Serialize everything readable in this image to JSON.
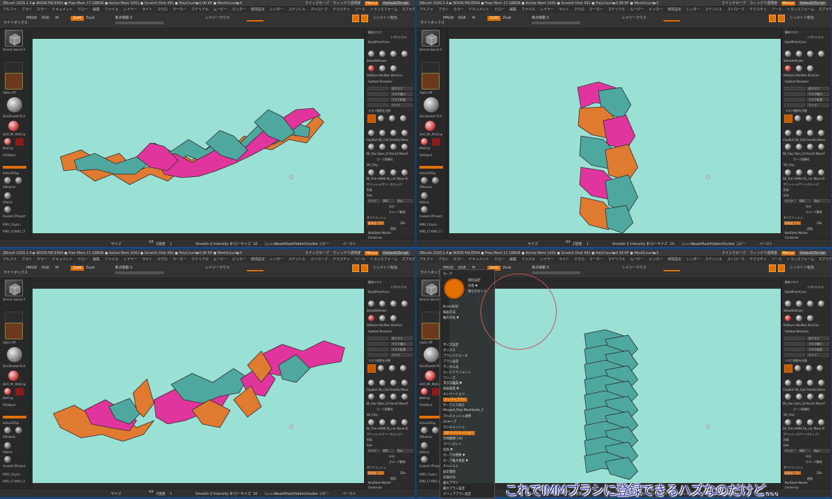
{
  "panes": [
    {
      "id": "pane1",
      "titlebar": {
        "title": "ZBrush 2020.1.4 ▶ BOON FACE004 ● Free Mem 17.188GB ● Active Mem 1041 ● Scratch Disk 491 ● PolyCount▶0.06 KP ● MeshCount▶3",
        "quicksave": "クイックセーブ",
        "transparency": "ウィンドウ透明度",
        "menus_tag": "Menus",
        "script": "DefaultZScript"
      },
      "menubar": [
        "アルファ",
        "ブラシ",
        "カラー",
        "ドキュメント",
        "ドロー",
        "編集",
        "ファイル",
        "レイヤー",
        "ライト",
        "マクロ",
        "マーカー",
        "マテリアル",
        "ムービー",
        "ピッカー",
        "環境設定",
        "レンダー",
        "ステンシル",
        "ストローク",
        "テクスチャ",
        "ツール",
        "トランスフォーム",
        "Zプラグイン",
        "Zスクリプト",
        "Zscript3",
        "Zscript2",
        "ヘルプ"
      ],
      "toolbar": {
        "lightbox": "ライトボックス",
        "mrgb": "MRGB",
        "rgb": "RGB",
        "m": "M",
        "zadd": "Zadd",
        "zsub": "Zsub",
        "focal": "焦点移動 0",
        "lazy": "レイジーマウス",
        "sym": "シンメトリ有効",
        "dynamic": "トポロジカル"
      },
      "leftpanel": {
        "tool_label": "Qmesh Swivel A",
        "alpha_label": "Alpha Off",
        "texture_label": "SkinShade4 PLA",
        "matcap_label": "zbr0_Mr_MatCap",
        "matcap2_label": "MatCap",
        "fill_label": "FillObject",
        "activate_label": "ActiveToTop",
        "brush1": "ZModeler",
        "brush2": "hPolish",
        "brush3": "SnakeH ZProject",
        "brush4": "KMO_ClayLin",
        "brush5": "KMO_Cf KMO_Cf",
        "brush6": "Anit Anit"
      },
      "rightpanel": {
        "mask_title": "胴体マスク",
        "topo": "トポロジカル",
        "geom": "EpolitFromCurv",
        "smooth": "SmoothAlcoes",
        "select": "SelectRe SelectLa",
        "dedue": "DeDuen SkinRen SliceCur",
        "subtool": "Subtool Renamer",
        "rev": "逆マスク",
        "mask_shrink": "マスク縮小",
        "mask_blur": "マスク拡張",
        "clear": "クリア",
        "mask_pt": "マスク境界を分割",
        "clay1": "ClayBuil SK_Clot FormSo Move",
        "clay2": "SK_Slas Dam_St Pinch2 MoveT",
        "curve": "カーブ画像化",
        "sk_clay": "SK_Clay",
        "trim": "SK_Trim HARK Sh_cnc Move El",
        "poly": "ポリッシュ(クリースエッジ)",
        "poly2": "形板",
        "sub": "Sub",
        "clear2": "クリア",
        "s": "SKS",
        "d": "Dyn",
        "half": "半分",
        "group": "グループ解除",
        "dynamic_mesh": "ダイナミッシュ",
        "res": "解像度 128",
        "slider": "ZRe",
        "proj": "透過",
        "cent": "Centering",
        "nudge": "NudSteel Master"
      },
      "bottombar": {
        "size": "サイズ",
        "size_val": "64",
        "strength": "Z強度",
        "strength_val": "1",
        "smooth": "Smooth Z Intensity 1",
        "draw": "ドローサイズ",
        "draw_val": "10",
        "dynamic_tag": "Dynamic",
        "reset": "ResetMaskHiddenDouble",
        "copy": "コピー",
        "paste": "ペースト"
      }
    },
    {
      "id": "pane2"
    },
    {
      "id": "pane3"
    },
    {
      "id": "pane4"
    }
  ],
  "menu_popup": {
    "top": {
      "header": "カーブ",
      "items": [
        "鈍化設定",
        "深度 ▼",
        "滑らかセット"
      ]
    },
    "mid": {
      "items": [
        "Brush形状",
        "描画方法",
        "軸方向化 ▼"
      ]
    },
    "list": [
      "サイズ設定",
      "ボックス",
      "ブラシパラメータ",
      "ブラシ設定",
      "ランダム化",
      "エンドアライメント",
      "フリーズ",
      "ラップモード"
    ],
    "lower": [
      "ブラシ設定 ▼",
      "描画速度 ▼",
      "エレベーション",
      "ティルトブラシ",
      "サーフェス高さ",
      "Merged_Poly MeshSuite_2",
      "マルチメッシュ適用",
      "ZSキープ",
      "マルチメッシュ",
      "2Dリゾリューション",
      "空間補間 130",
      "スペースレン",
      "延長 ▼",
      "カーブ分割数 ▼",
      "カーブ最大角度 ▼",
      "チルトルト",
      "固定連続",
      "前面のみ",
      "最大ブラシ",
      "最大ブラシ設定",
      "クリップブラシ設定"
    ]
  },
  "caption": "これでIMMブラシに登録できるハズなのだけど…"
}
